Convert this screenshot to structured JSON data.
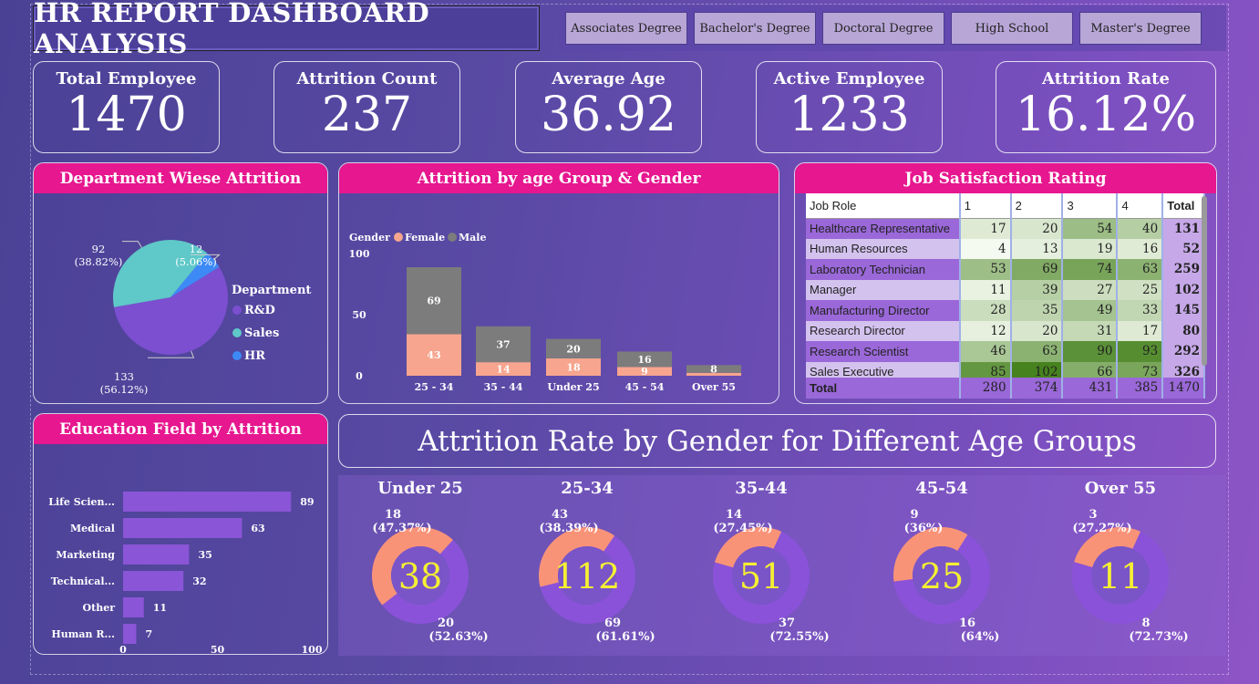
{
  "title": "HR REPORT DASHBOARD ANALYSIS",
  "filters": [
    "Associates Degree",
    "Bachelor's Degree",
    "Doctoral Degree",
    "High School",
    "Master's Degree"
  ],
  "kpis": [
    {
      "label": "Total Employee",
      "value": "1470"
    },
    {
      "label": "Attrition Count",
      "value": "237"
    },
    {
      "label": "Average Age",
      "value": "36.92"
    },
    {
      "label": "Active Employee",
      "value": "1233"
    },
    {
      "label": "Attrition Rate",
      "value": "16.12%"
    }
  ],
  "dept_panel": {
    "title": "Department Wiese Attrition",
    "legend_title": "Department",
    "colors": {
      "R&D": "#7b4fd0",
      "Sales": "#5fc8c8",
      "HR": "#3d8af7"
    },
    "chart_data": {
      "type": "pie",
      "categories": [
        "R&D",
        "Sales",
        "HR"
      ],
      "values": [
        133,
        92,
        12
      ],
      "labels": [
        [
          "133",
          "(56.12%)"
        ],
        [
          "92",
          "(38.82%)"
        ],
        [
          "12",
          "(5.06%)"
        ]
      ]
    }
  },
  "age_panel": {
    "title": "Attrition by age Group & Gender",
    "legend_title": "Gender",
    "colors": {
      "Female": "#f7a58e",
      "Male": "#7c7c7c"
    },
    "chart_data": {
      "type": "bar",
      "stacked": true,
      "categories": [
        "25 - 34",
        "35 - 44",
        "Under 25",
        "45 - 54",
        "Over 55"
      ],
      "series": [
        {
          "name": "Female",
          "values": [
            43,
            14,
            18,
            9,
            3
          ]
        },
        {
          "name": "Male",
          "values": [
            69,
            37,
            20,
            16,
            8
          ]
        }
      ],
      "ylim": [
        0,
        112
      ],
      "yticks": [
        0,
        50,
        100
      ],
      "female_labels": [
        "43",
        "14",
        "18",
        "9",
        ""
      ],
      "male_labels": [
        "69",
        "37",
        "20",
        "16",
        "8"
      ]
    }
  },
  "job_panel": {
    "title": "Job Satisfaction Rating",
    "headers": [
      "Job Role",
      "1",
      "2",
      "3",
      "4",
      "Total"
    ],
    "rows": [
      [
        "Healthcare Representative",
        "17",
        "20",
        "54",
        "40",
        "131"
      ],
      [
        "Human Resources",
        "4",
        "13",
        "19",
        "16",
        "52"
      ],
      [
        "Laboratory Technician",
        "53",
        "69",
        "74",
        "63",
        "259"
      ],
      [
        "Manager",
        "11",
        "39",
        "27",
        "25",
        "102"
      ],
      [
        "Manufacturing Director",
        "28",
        "35",
        "49",
        "33",
        "145"
      ],
      [
        "Research Director",
        "12",
        "20",
        "31",
        "17",
        "80"
      ],
      [
        "Research Scientist",
        "46",
        "63",
        "90",
        "93",
        "292"
      ],
      [
        "Sales Executive",
        "85",
        "102",
        "66",
        "73",
        "326"
      ]
    ],
    "footer": [
      "Total",
      "280",
      "374",
      "431",
      "385",
      "1470"
    ]
  },
  "edu_panel": {
    "title": "Education Field by Attrition",
    "bar_color": "#8a55d6",
    "chart_data": {
      "type": "bar",
      "orientation": "horizontal",
      "categories": [
        "Life Scien...",
        "Medical",
        "Marketing",
        "Technical...",
        "Other",
        "Human R..."
      ],
      "values": [
        89,
        63,
        35,
        32,
        11,
        7
      ],
      "xlim": [
        0,
        100
      ],
      "xticks": [
        0,
        50,
        100
      ]
    }
  },
  "gender_section": {
    "title": "Attrition Rate by Gender for Different Age Groups",
    "colors": {
      "female": "#f99378",
      "male": "#8a52d9",
      "center_text": "#f5f032"
    },
    "chart_data": [
      {
        "type": "pie",
        "group": "Under 25",
        "total": "38",
        "values": [
          18,
          20
        ],
        "labels": [
          [
            "18",
            "(47.37%)"
          ],
          [
            "20",
            "(52.63%)"
          ]
        ]
      },
      {
        "type": "pie",
        "group": "25-34",
        "total": "112",
        "values": [
          43,
          69
        ],
        "labels": [
          [
            "43",
            "(38.39%)"
          ],
          [
            "69",
            "(61.61%)"
          ]
        ]
      },
      {
        "type": "pie",
        "group": "35-44",
        "total": "51",
        "values": [
          14,
          37
        ],
        "labels": [
          [
            "14",
            "(27.45%)"
          ],
          [
            "37",
            "(72.55%)"
          ]
        ]
      },
      {
        "type": "pie",
        "group": "45-54",
        "total": "25",
        "values": [
          9,
          16
        ],
        "labels": [
          [
            "9",
            "(36%)"
          ],
          [
            "16",
            "(64%)"
          ]
        ]
      },
      {
        "type": "pie",
        "group": "Over 55",
        "total": "11",
        "values": [
          3,
          8
        ],
        "labels": [
          [
            "3",
            "(27.27%)"
          ],
          [
            "8",
            "(72.73%)"
          ]
        ]
      }
    ]
  }
}
